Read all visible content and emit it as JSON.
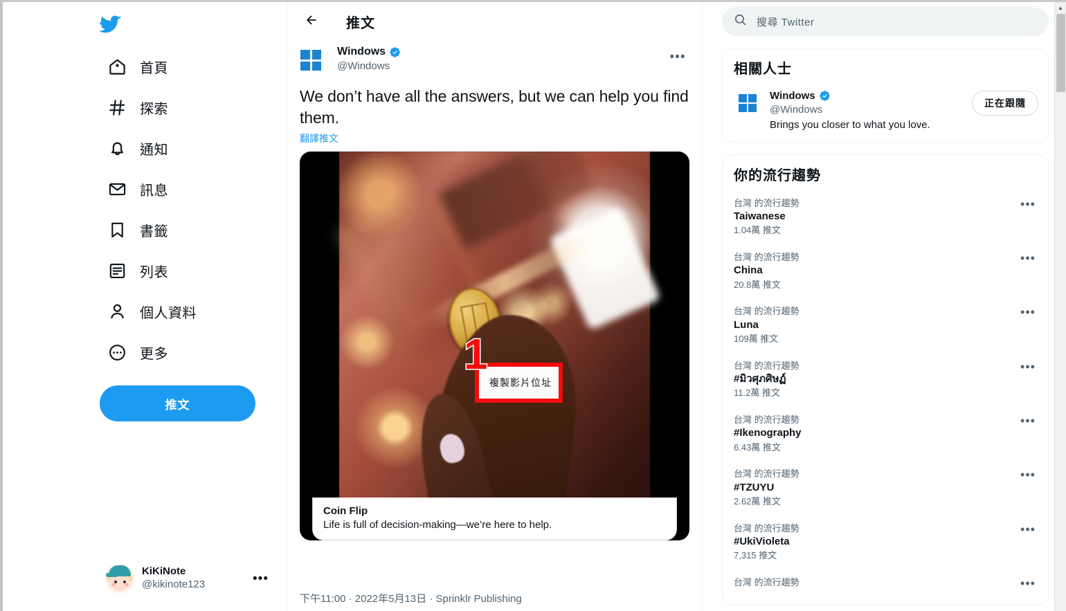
{
  "sidebar": {
    "logo_icon": "twitter-bird-icon",
    "items": [
      {
        "icon": "home-icon",
        "label": "首頁"
      },
      {
        "icon": "hashtag-icon",
        "label": "探索"
      },
      {
        "icon": "bell-icon",
        "label": "通知"
      },
      {
        "icon": "envelope-icon",
        "label": "訊息"
      },
      {
        "icon": "bookmark-icon",
        "label": "書籤"
      },
      {
        "icon": "list-icon",
        "label": "列表"
      },
      {
        "icon": "person-icon",
        "label": "個人資料"
      },
      {
        "icon": "more-circle-icon",
        "label": "更多"
      }
    ],
    "compose_label": "推文",
    "account": {
      "name": "KiKiNote",
      "handle": "@kikinote123",
      "more_icon": "more-horizontal-icon"
    }
  },
  "center": {
    "back_icon": "arrow-left-icon",
    "title": "推文",
    "tweet": {
      "author_name": "Windows",
      "author_handle": "@Windows",
      "verified_icon": "verified-badge-icon",
      "avatar_icon": "windows-logo-icon",
      "more_icon": "more-horizontal-icon",
      "text": "We don’t have all the answers, but we can help you find them.",
      "translate_label": "翻譯推文",
      "media": {
        "context_menu_label": "複製影片位址",
        "step_number": "1",
        "card_title": "Coin Flip",
        "card_description": "Life is full of decision-making—we’re here to help."
      },
      "meta": "下午11:00 · 2022年5月13日 · Sprinklr Publishing"
    }
  },
  "right": {
    "search": {
      "icon": "search-icon",
      "placeholder": "搜尋 Twitter"
    },
    "who_to_follow": {
      "title": "相關人士",
      "user": {
        "name": "Windows",
        "handle": "@Windows",
        "verified_icon": "verified-badge-icon",
        "avatar_icon": "windows-logo-icon",
        "bio": "Brings you closer to what you love.",
        "follow_button": "正在跟隨"
      }
    },
    "trends": {
      "title": "你的流行趨勢",
      "items": [
        {
          "category": "台灣 的流行趨勢",
          "name": "Taiwanese",
          "count": "1.04萬 推文",
          "more_icon": "more-horizontal-icon"
        },
        {
          "category": "台灣 的流行趨勢",
          "name": "China",
          "count": "20.8萬 推文",
          "more_icon": "more-horizontal-icon"
        },
        {
          "category": "台灣 的流行趨勢",
          "name": "Luna",
          "count": "109萬 推文",
          "more_icon": "more-horizontal-icon"
        },
        {
          "category": "台灣 的流行趨勢",
          "name": "#มิวศุภศิษฏ์",
          "count": "11.2萬 推文",
          "more_icon": "more-horizontal-icon"
        },
        {
          "category": "台灣 的流行趨勢",
          "name": "#Ikenography",
          "count": "6.43萬 推文",
          "more_icon": "more-horizontal-icon"
        },
        {
          "category": "台灣 的流行趨勢",
          "name": "#TZUYU",
          "count": "2.62萬 推文",
          "more_icon": "more-horizontal-icon"
        },
        {
          "category": "台灣 的流行趨勢",
          "name": "#UkiVioleta",
          "count": "7,315 推文",
          "more_icon": "more-horizontal-icon"
        },
        {
          "category": "台灣 的流行趨勢",
          "name": "",
          "count": "",
          "more_icon": "more-horizontal-icon"
        }
      ]
    }
  },
  "scrollbar": {
    "up_arrow_icon": "chevron-up-icon"
  },
  "colors": {
    "accent": "#1d9bf0",
    "annotation_red": "#f40c0c",
    "text_primary": "#0f1419",
    "text_secondary": "#536471",
    "windows_blue": "#1b83d4"
  }
}
